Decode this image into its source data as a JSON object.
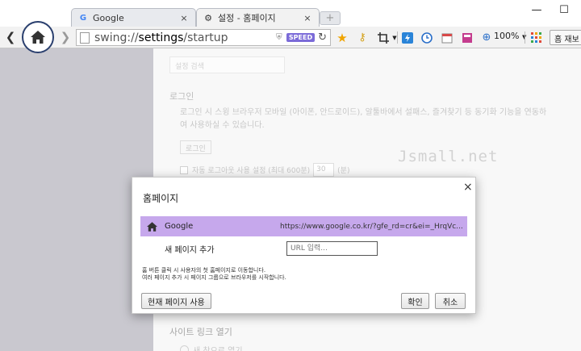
{
  "window": {
    "minimize": "—",
    "maximize": "☐"
  },
  "tabs": [
    {
      "label": "Google",
      "icon": "google-g-icon",
      "close": "×"
    },
    {
      "label": "설정 - 홈페이지",
      "icon": "gear-icon",
      "close": "×"
    }
  ],
  "newtab": "+",
  "nav": {
    "back": "❮",
    "forward": "❯"
  },
  "omnibox": {
    "scheme": "swing://",
    "host": "settings",
    "path": "/startup",
    "speed_badge": "SPEED"
  },
  "toolbar": {
    "zoom": "100%",
    "home_set": "홈 재보"
  },
  "settings": {
    "search_placeholder": "설정 검색",
    "login_section": "로그인",
    "login_desc": "로그인 시 스윙 브라우저 모바일 (아이폰, 안드로이드), 알툴바에서 설패스, 즐겨찾기 등 동기화 기능을 연동하여 사용하실 수 있습니다.",
    "login_button": "로그인",
    "autologout_label": "자동 로그아웃 사용 설정 (최대 600분)",
    "autologout_value": "30",
    "autologout_unit": "(분)",
    "watermark": "Jsmall.net",
    "site_link_section": "사이트 링크 열기",
    "site_link_option": "새 창으로 열기"
  },
  "dialog": {
    "title": "홈페이지",
    "close": "×",
    "entries": [
      {
        "name": "Google",
        "url": "https://www.google.co.kr/?gfe_rd=cr&ei=_HrqVc..."
      }
    ],
    "add_label": "새 페이지 추가",
    "url_placeholder": "URL 입력...",
    "note_line1": "홈 버튼 클릭 시 사용자의 첫 홈페이지로 이동합니다.",
    "note_line2": "여러 페이지 추가 시 페이지 그룹으로 브라우저를 시작합니다.",
    "use_current": "현재 페이지 사용",
    "ok": "확인",
    "cancel": "취소"
  }
}
